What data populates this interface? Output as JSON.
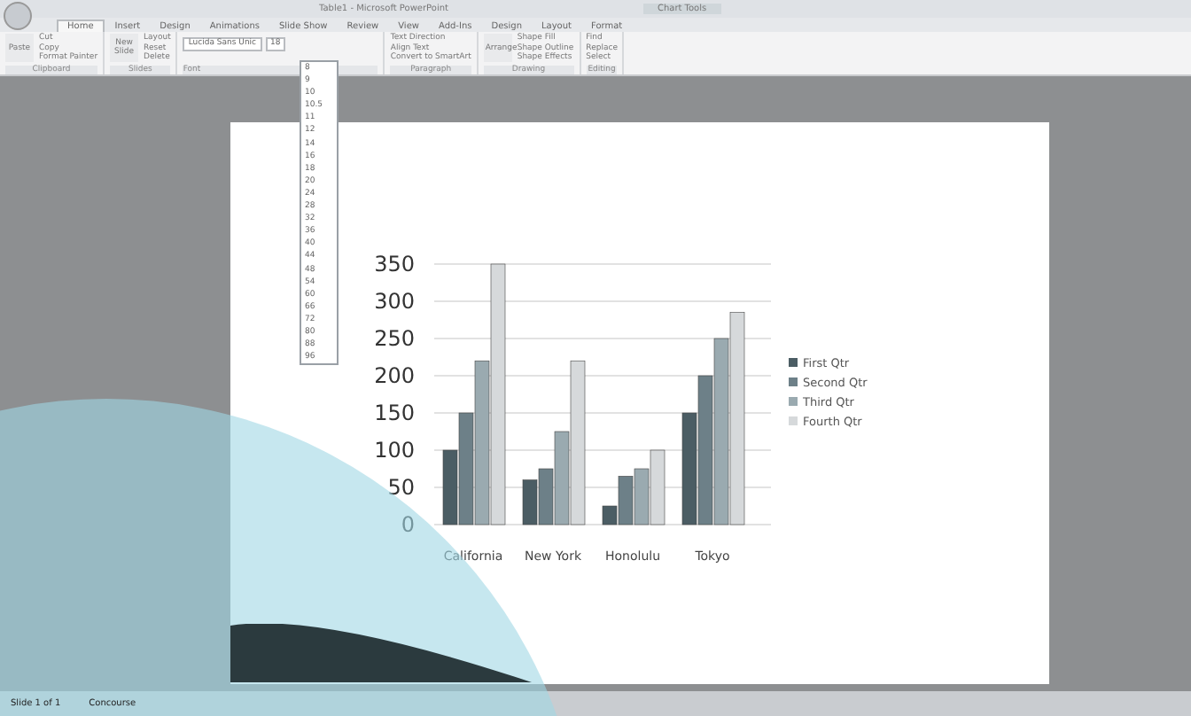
{
  "window": {
    "title": "Table1 - Microsoft PowerPoint",
    "context_tab": "Chart Tools"
  },
  "tabs": [
    {
      "label": "Home",
      "selected": true
    },
    {
      "label": "Insert",
      "selected": false
    },
    {
      "label": "Design",
      "selected": false
    },
    {
      "label": "Animations",
      "selected": false
    },
    {
      "label": "Slide Show",
      "selected": false
    },
    {
      "label": "Review",
      "selected": false
    },
    {
      "label": "View",
      "selected": false
    },
    {
      "label": "Add-Ins",
      "selected": false
    },
    {
      "label": "Design",
      "selected": false
    },
    {
      "label": "Layout",
      "selected": false
    },
    {
      "label": "Format",
      "selected": false
    }
  ],
  "ribbon": {
    "groups": [
      {
        "label": "Clipboard",
        "big": "Paste",
        "commands": [
          "Cut",
          "Copy",
          "Format Painter"
        ]
      },
      {
        "label": "Slides",
        "big": "New Slide",
        "commands": [
          "Layout",
          "Reset",
          "Delete"
        ]
      },
      {
        "label": "Font"
      },
      {
        "label": "Paragraph",
        "commands": [
          "Text Direction",
          "Align Text",
          "Convert to SmartArt"
        ]
      },
      {
        "label": "Drawing",
        "big": "Arrange",
        "commands": [
          "Shape Fill",
          "Shape Outline",
          "Shape Effects"
        ]
      },
      {
        "label": "Editing",
        "commands": [
          "Find",
          "Replace",
          "Select"
        ]
      }
    ]
  },
  "font_box": {
    "font": "Lucida Sans Unic",
    "size": "18"
  },
  "size_menu": {
    "items": [
      "8",
      "9",
      "10",
      "10.5",
      "11",
      "12",
      "14",
      "16",
      "18",
      "20",
      "24",
      "28",
      "32",
      "36",
      "40",
      "44",
      "48",
      "54",
      "60",
      "66",
      "72",
      "80",
      "88",
      "96"
    ]
  },
  "chart": {
    "chart_data": {
      "type": "bar",
      "categories": [
        "California",
        "New York",
        "Honolulu",
        "Tokyo"
      ],
      "series": [
        {
          "name": "First Qtr",
          "color": "#4b5d64",
          "values": [
            100,
            60,
            25,
            150
          ]
        },
        {
          "name": "Second Qtr",
          "color": "#6d8088",
          "values": [
            150,
            75,
            65,
            200
          ]
        },
        {
          "name": "Third Qtr",
          "color": "#9aaab0",
          "values": [
            220,
            125,
            75,
            250
          ]
        },
        {
          "name": "Fourth Qtr",
          "color": "#d6d9db",
          "values": [
            350,
            220,
            100,
            285
          ]
        }
      ],
      "grid": true,
      "legend": "right",
      "ylim": [
        0,
        350
      ],
      "yticks": [
        0,
        50,
        100,
        150,
        200,
        250,
        300,
        350
      ]
    }
  },
  "status_bar": {
    "items": [
      "Slide 1 of 1",
      "Concourse"
    ]
  }
}
